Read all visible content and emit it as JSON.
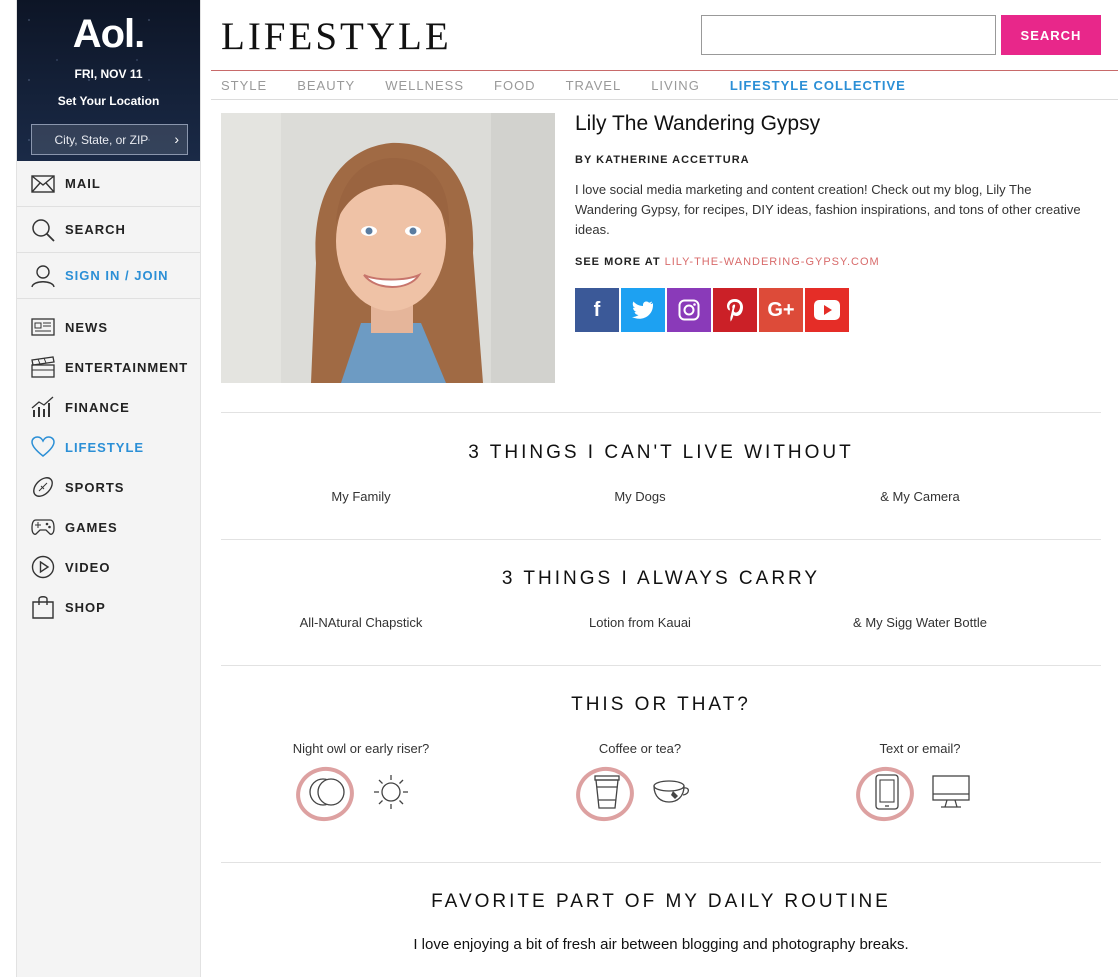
{
  "sidebar": {
    "brand": {
      "logo": "Aol.",
      "date": "FRI, NOV 11",
      "location_prompt": "Set Your Location",
      "location_placeholder": "City, State, or ZIP"
    },
    "top_items": [
      {
        "label": "MAIL",
        "icon": "mail-icon"
      },
      {
        "label": "SEARCH",
        "icon": "search-icon"
      },
      {
        "label": "SIGN IN / JOIN",
        "icon": "user-icon"
      }
    ],
    "items": [
      {
        "label": "NEWS",
        "icon": "news-icon"
      },
      {
        "label": "ENTERTAINMENT",
        "icon": "clapperboard-icon"
      },
      {
        "label": "FINANCE",
        "icon": "chart-icon"
      },
      {
        "label": "LIFESTYLE",
        "icon": "heart-icon"
      },
      {
        "label": "SPORTS",
        "icon": "football-icon"
      },
      {
        "label": "GAMES",
        "icon": "gamepad-icon"
      },
      {
        "label": "VIDEO",
        "icon": "play-icon"
      },
      {
        "label": "SHOP",
        "icon": "shopping-bag-icon"
      }
    ]
  },
  "header": {
    "logo": "LIFESTYLE",
    "search_placeholder": "",
    "search_label": "SEARCH",
    "nav": [
      "STYLE",
      "BEAUTY",
      "WELLNESS",
      "FOOD",
      "TRAVEL",
      "LIVING",
      "LIFESTYLE COLLECTIVE"
    ],
    "active_nav": "LIFESTYLE COLLECTIVE"
  },
  "profile": {
    "name": "Lily The Wandering Gypsy",
    "byline": "BY KATHERINE ACCETTURA",
    "bio": "I love social media marketing and content creation! Check out my blog, Lily The Wandering Gypsy, for recipes, DIY ideas, fashion inspirations, and tons of other creative ideas.",
    "see_more_label": "SEE MORE AT",
    "see_more_link": "LILY-THE-WANDERING-GYPSY.COM",
    "social": [
      {
        "name": "facebook",
        "glyph": "f",
        "color": "#3b5998"
      },
      {
        "name": "twitter",
        "glyph": "t",
        "color": "#1da1f2"
      },
      {
        "name": "instagram",
        "glyph": "◎",
        "color": "#8a3ab9"
      },
      {
        "name": "pinterest",
        "glyph": "P",
        "color": "#cb2027"
      },
      {
        "name": "google-plus",
        "glyph": "G+",
        "color": "#dd4b39"
      },
      {
        "name": "youtube",
        "glyph": "▶",
        "color": "#e52d27"
      }
    ]
  },
  "sections": {
    "cant_live": {
      "title": "3 THINGS I CAN'T LIVE WITHOUT",
      "items": [
        "My Family",
        "My Dogs",
        "& My Camera"
      ]
    },
    "always_carry": {
      "title": "3 THINGS I ALWAYS CARRY",
      "items": [
        "All-NAtural Chapstick",
        "Lotion from Kauai",
        "& My Sigg Water Bottle"
      ]
    },
    "this_or_that": {
      "title": "THIS OR THAT?",
      "questions": [
        {
          "label": "Night owl or early riser?",
          "options": [
            "moon-icon",
            "sun-icon"
          ],
          "selected": 0
        },
        {
          "label": "Coffee or tea?",
          "options": [
            "coffee-cup-icon",
            "teacup-icon"
          ],
          "selected": 0
        },
        {
          "label": "Text or email?",
          "options": [
            "phone-icon",
            "computer-icon"
          ],
          "selected": 0
        }
      ]
    },
    "routine": {
      "title": "FAVORITE PART OF MY DAILY ROUTINE",
      "text": "I love enjoying a bit of fresh air between blogging and photography breaks."
    }
  }
}
